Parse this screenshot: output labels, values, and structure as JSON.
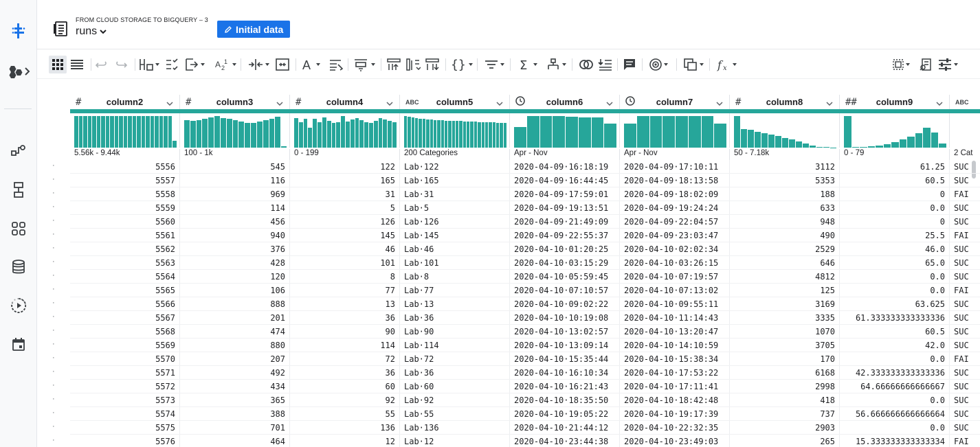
{
  "header": {
    "subtitle": "FROM CLOUD STORAGE TO BIGQUERY – 3",
    "title": "runs",
    "initial_button": "Initial data"
  },
  "rail": {
    "icons": [
      "dataprep-logo-icon",
      "hexagon-flow-icon",
      "flow-icon",
      "recipe-icon",
      "library-icon",
      "database-icon",
      "jobs-icon",
      "schedule-icon"
    ]
  },
  "toolbar": {
    "icons": [
      "grid-view-icon",
      "list-view-icon",
      "undo-icon",
      "redo-icon",
      "rename-column-icon",
      "check-list-icon",
      "move-column-icon",
      "sort-icon",
      "split-column-icon",
      "merge-column-icon",
      "text-format-icon",
      "replace-icon",
      "restructure-icon",
      "pivot-icon",
      "unpivot-icon",
      "rename-icon",
      "nested-icon",
      "filter-icon",
      "aggregate-icon",
      "hierarchy-icon",
      "join-icon",
      "lookup-icon",
      "comment-icon",
      "target-icon",
      "duplicate-icon",
      "function-icon",
      "select-all-icon",
      "column-details-icon",
      "settings-icon"
    ]
  },
  "columns": [
    {
      "type": "#",
      "name": "column2",
      "range": "5.56k - 9.44k",
      "align": "num",
      "hist": [
        95,
        95,
        95,
        95,
        95,
        95,
        95,
        95,
        95,
        95,
        95,
        95,
        95,
        95,
        95,
        95,
        95,
        95,
        95,
        95,
        95,
        95,
        20
      ]
    },
    {
      "type": "#",
      "name": "column3",
      "range": "100 - 1k",
      "align": "num",
      "hist": [
        84,
        82,
        84,
        88,
        92,
        96,
        90,
        88,
        84,
        80,
        74,
        76,
        80,
        84,
        88,
        94,
        4
      ]
    },
    {
      "type": "#",
      "name": "column4",
      "range": "0 - 199",
      "align": "num",
      "hist": [
        90,
        78,
        88,
        60,
        88,
        78,
        92,
        82,
        74,
        78,
        96,
        80,
        86,
        90,
        84,
        78,
        74,
        82,
        90,
        86,
        82,
        78
      ]
    },
    {
      "type": "ABC",
      "name": "column5",
      "range": "200 Categories",
      "align": "txt",
      "hist": [
        96,
        94,
        92,
        90,
        88,
        88,
        86,
        86,
        84,
        84,
        84,
        82,
        82,
        82,
        82,
        82,
        80,
        80,
        80,
        80,
        78,
        78,
        78,
        78,
        78,
        76,
        76,
        76
      ]
    },
    {
      "type": "clock",
      "name": "column6",
      "range": "Apr - Nov",
      "align": "txt",
      "hist": [
        62,
        96,
        96,
        96,
        94,
        92,
        92,
        72
      ]
    },
    {
      "type": "clock",
      "name": "column7",
      "range": "Apr - Nov",
      "align": "txt",
      "hist": [
        72,
        96,
        96,
        96,
        96,
        96,
        96,
        72
      ]
    },
    {
      "type": "#",
      "name": "column8",
      "range": "50 - 7.18k",
      "align": "num",
      "hist": [
        96,
        56,
        54,
        48,
        44,
        40,
        36,
        30,
        24,
        18,
        12,
        6,
        3,
        2,
        0
      ]
    },
    {
      "type": "##",
      "name": "column9",
      "range": "0 - 79",
      "align": "num",
      "hist": [
        96,
        2,
        2,
        4,
        6,
        10,
        16,
        24,
        34,
        44,
        60,
        46,
        12
      ]
    },
    {
      "type": "ABC",
      "name": "",
      "range": "2 Cat",
      "align": "txt",
      "hist": []
    }
  ],
  "rows": [
    [
      "5556",
      "545",
      "122",
      "Lab·122",
      "2020-04-09·16:18:19",
      "2020-04-09·17:10:11",
      "3112",
      "61.25",
      "SUC"
    ],
    [
      "5557",
      "116",
      "165",
      "Lab·165",
      "2020-04-09·16:44:45",
      "2020-04-09·18:13:58",
      "5353",
      "60.5",
      "SUC"
    ],
    [
      "5558",
      "969",
      "31",
      "Lab·31",
      "2020-04-09·17:59:01",
      "2020-04-09·18:02:09",
      "188",
      "0",
      "FAI"
    ],
    [
      "5559",
      "114",
      "5",
      "Lab·5",
      "2020-04-09·19:13:51",
      "2020-04-09·19:24:24",
      "633",
      "0.0",
      "SUC"
    ],
    [
      "5560",
      "456",
      "126",
      "Lab·126",
      "2020-04-09·21:49:09",
      "2020-04-09·22:04:57",
      "948",
      "0",
      "SUC"
    ],
    [
      "5561",
      "940",
      "145",
      "Lab·145",
      "2020-04-09·22:55:37",
      "2020-04-09·23:03:47",
      "490",
      "25.5",
      "FAI"
    ],
    [
      "5562",
      "376",
      "46",
      "Lab·46",
      "2020-04-10·01:20:25",
      "2020-04-10·02:02:34",
      "2529",
      "46.0",
      "SUC"
    ],
    [
      "5563",
      "428",
      "101",
      "Lab·101",
      "2020-04-10·03:15:29",
      "2020-04-10·03:26:15",
      "646",
      "65.0",
      "SUC"
    ],
    [
      "5564",
      "120",
      "8",
      "Lab·8",
      "2020-04-10·05:59:45",
      "2020-04-10·07:19:57",
      "4812",
      "0.0",
      "SUC"
    ],
    [
      "5565",
      "106",
      "77",
      "Lab·77",
      "2020-04-10·07:10:57",
      "2020-04-10·07:13:02",
      "125",
      "0.0",
      "FAI"
    ],
    [
      "5566",
      "888",
      "13",
      "Lab·13",
      "2020-04-10·09:02:22",
      "2020-04-10·09:55:11",
      "3169",
      "63.625",
      "SUC"
    ],
    [
      "5567",
      "201",
      "36",
      "Lab·36",
      "2020-04-10·10:19:08",
      "2020-04-10·11:14:43",
      "3335",
      "61.333333333333336",
      "SUC"
    ],
    [
      "5568",
      "474",
      "90",
      "Lab·90",
      "2020-04-10·13:02:57",
      "2020-04-10·13:20:47",
      "1070",
      "60.5",
      "SUC"
    ],
    [
      "5569",
      "880",
      "114",
      "Lab·114",
      "2020-04-10·13:09:14",
      "2020-04-10·14:10:59",
      "3705",
      "42.0",
      "SUC"
    ],
    [
      "5570",
      "207",
      "72",
      "Lab·72",
      "2020-04-10·15:35:44",
      "2020-04-10·15:38:34",
      "170",
      "0.0",
      "FAI"
    ],
    [
      "5571",
      "492",
      "36",
      "Lab·36",
      "2020-04-10·16:10:34",
      "2020-04-10·17:53:22",
      "6168",
      "42.333333333333336",
      "SUC"
    ],
    [
      "5572",
      "434",
      "60",
      "Lab·60",
      "2020-04-10·16:21:43",
      "2020-04-10·17:11:41",
      "2998",
      "64.66666666666667",
      "SUC"
    ],
    [
      "5573",
      "365",
      "92",
      "Lab·92",
      "2020-04-10·18:35:50",
      "2020-04-10·18:42:48",
      "418",
      "0.0",
      "SUC"
    ],
    [
      "5574",
      "388",
      "55",
      "Lab·55",
      "2020-04-10·19:05:22",
      "2020-04-10·19:17:39",
      "737",
      "56.666666666666664",
      "SUC"
    ],
    [
      "5575",
      "701",
      "136",
      "Lab·136",
      "2020-04-10·21:44:12",
      "2020-04-10·22:32:35",
      "2903",
      "0.0",
      "SUC"
    ],
    [
      "5576",
      "464",
      "12",
      "Lab·12",
      "2020-04-10·23:44:38",
      "2020-04-10·23:49:03",
      "265",
      "15.333333333333334",
      "FAI"
    ]
  ],
  "colors": {
    "accent": "#1a73e8",
    "teal": "#26a69a",
    "rail_bg": "#f8f9fa"
  }
}
